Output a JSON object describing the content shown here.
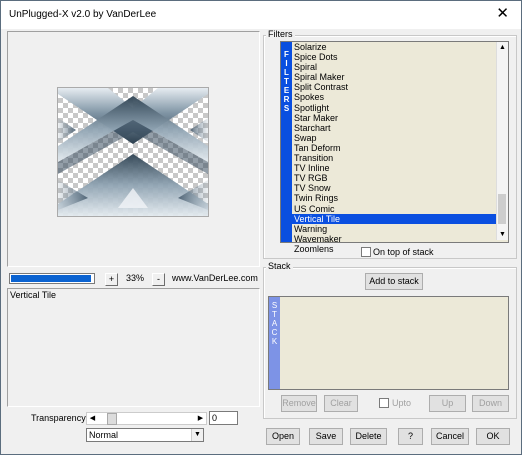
{
  "window": {
    "title": "UnPlugged-X v2.0 by VanDerLee",
    "close_glyph": "✕"
  },
  "preview": {
    "progress_fraction": 0.98,
    "zoom_minus": "-",
    "zoom_plus": "+",
    "zoom_value": "33%",
    "site": "www.VanDerLee.com",
    "param_title": "Vertical Tile"
  },
  "transparency": {
    "label": "Transparency",
    "value": "0"
  },
  "blend": {
    "selected": "Normal"
  },
  "filters": {
    "group_label": "Filters",
    "vertical_label": [
      "F",
      "I",
      "L",
      "T",
      "E",
      "R",
      "S"
    ],
    "items": [
      "Solarize",
      "Spice Dots",
      "Spiral",
      "Spiral Maker",
      "Split Contrast",
      "Spokes",
      "Spotlight",
      "Star Maker",
      "Starchart",
      "Swap",
      "Tan Deform",
      "Transition",
      "TV Inline",
      "TV RGB",
      "TV Snow",
      "Twin Rings",
      "US Comic",
      "Vertical Tile",
      "Warning",
      "Wavemaker",
      "Zoomlens"
    ],
    "selected": "Vertical Tile",
    "on_top_label": "On top of stack"
  },
  "stack": {
    "group_label": "Stack",
    "add_label": "Add to stack",
    "vertical_label": [
      "S",
      "T",
      "A",
      "C",
      "K"
    ],
    "remove_label": "Remove",
    "clear_label": "Clear",
    "upto_label": "Upto",
    "up_label": "Up",
    "down_label": "Down"
  },
  "footer": {
    "open_label": "Open",
    "save_label": "Save",
    "delete_label": "Delete",
    "help_label": "?",
    "cancel_label": "Cancel",
    "ok_label": "OK"
  },
  "colors": {
    "accent": "#0a4fe0",
    "list_bg": "#ece9d8",
    "stack_strip": "#7d93e6"
  }
}
